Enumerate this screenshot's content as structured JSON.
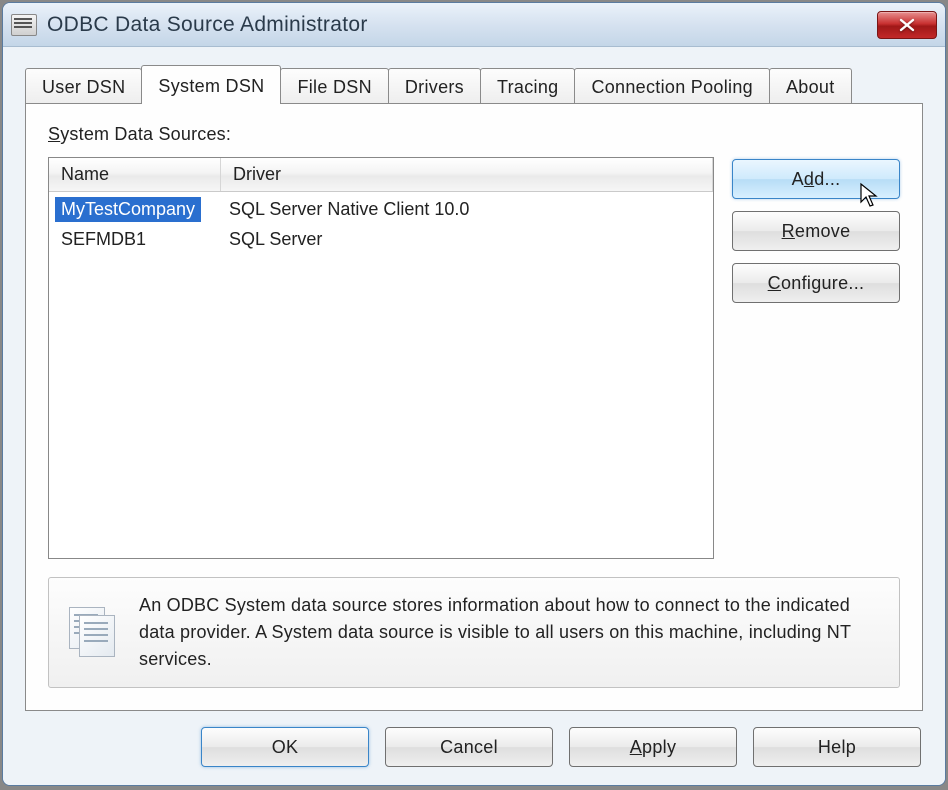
{
  "window": {
    "title": "ODBC Data Source Administrator"
  },
  "tabs": [
    {
      "label": "User DSN"
    },
    {
      "label": "System DSN"
    },
    {
      "label": "File DSN"
    },
    {
      "label": "Drivers"
    },
    {
      "label": "Tracing"
    },
    {
      "label": "Connection Pooling"
    },
    {
      "label": "About"
    }
  ],
  "active_tab_index": 1,
  "list": {
    "label_prefix": "S",
    "label_rest": "ystem Data Sources:",
    "columns": {
      "name": "Name",
      "driver": "Driver"
    },
    "rows": [
      {
        "name": "MyTestCompany",
        "driver": "SQL Server Native Client 10.0",
        "selected": true
      },
      {
        "name": "SEFMDB1",
        "driver": "SQL Server",
        "selected": false
      }
    ]
  },
  "side_buttons": {
    "add": {
      "prefix": "A",
      "u": "d",
      "suffix": "d..."
    },
    "remove": {
      "prefix": "",
      "u": "R",
      "suffix": "emove"
    },
    "configure": {
      "prefix": "",
      "u": "C",
      "suffix": "onfigure..."
    }
  },
  "info_text": "An ODBC System data source stores information about how to connect to the indicated data provider.   A System data source is visible to all users on this machine, including NT services.",
  "dialog_buttons": {
    "ok": "OK",
    "cancel": "Cancel",
    "apply": {
      "prefix": "",
      "u": "A",
      "suffix": "pply"
    },
    "help": "Help"
  }
}
